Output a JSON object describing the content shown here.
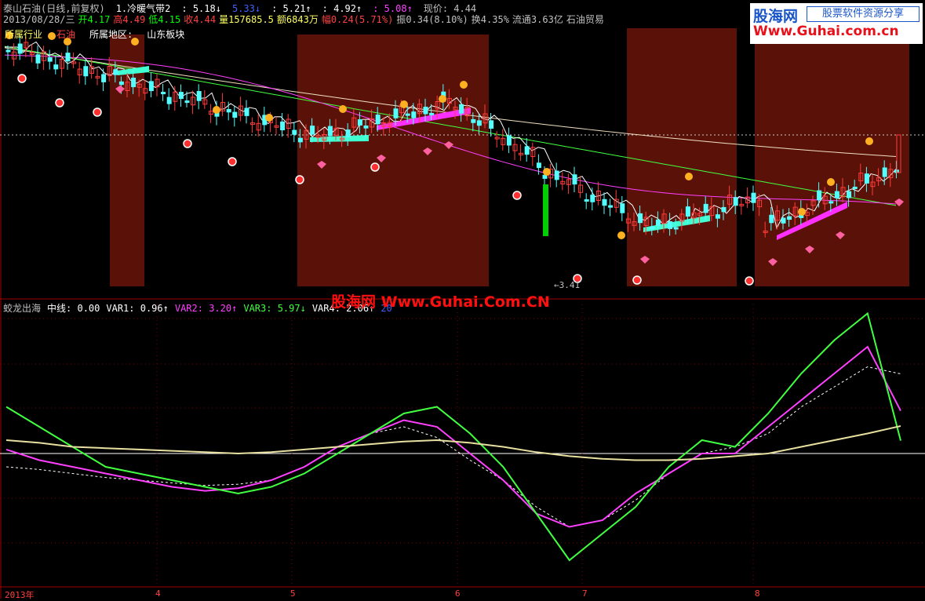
{
  "header": {
    "line1": [
      {
        "text": "泰山石油(日线,前复权)",
        "color": "#c0c0c0"
      },
      {
        "text": "1.冷暖气带2",
        "color": "#ffffff"
      },
      {
        "text": ": 5.18↓",
        "color": "#ffffff"
      },
      {
        "text": "5.33↓",
        "color": "#4060ff"
      },
      {
        "text": ": 5.21↑",
        "color": "#ffffff"
      },
      {
        "text": ": 4.92↑",
        "color": "#ffffff"
      },
      {
        "text": ": 5.08↑",
        "color": "#ff40ff"
      },
      {
        "text": "现价: 4.44",
        "color": "#c0c0c0"
      }
    ],
    "line2": [
      {
        "text": "2013/08/28/三",
        "color": "#c0c0c0"
      },
      {
        "text": "开4.17",
        "color": "#00ff00"
      },
      {
        "text": "高4.49",
        "color": "#ff4040"
      },
      {
        "text": "低4.15",
        "color": "#00ff00"
      },
      {
        "text": "收4.44",
        "color": "#ff4040"
      },
      {
        "text": "量157685.5",
        "color": "#ffff60"
      },
      {
        "text": "额6843万",
        "color": "#ffff60"
      },
      {
        "text": "幅0.24(5.71%)",
        "color": "#ff4040"
      },
      {
        "text": "振0.34(8.10%)",
        "color": "#c0c0c0"
      },
      {
        "text": "换4.35%",
        "color": "#c0c0c0"
      },
      {
        "text": "流通3.63亿",
        "color": "#c0c0c0"
      },
      {
        "text": "石油贸易",
        "color": "#c0c0c0"
      }
    ],
    "line3": [
      {
        "text": "所属行业",
        "color": "#ffff60"
      },
      {
        "text": "石油",
        "color": "#ff4040"
      },
      {
        "text": "所属地区:",
        "color": "#ffffff"
      },
      {
        "text": "山东板块",
        "color": "#ffffff"
      }
    ]
  },
  "indicator": {
    "items": [
      {
        "text": "蛟龙出海",
        "color": "#c0c0c0"
      },
      {
        "text": "中线: 0.00",
        "color": "#ffffff"
      },
      {
        "text": "VAR1: 0.96↑",
        "color": "#ffffff"
      },
      {
        "text": "VAR2: 3.20↑",
        "color": "#ff40ff"
      },
      {
        "text": "VAR3: 5.97↓",
        "color": "#40ff40"
      },
      {
        "text": "VAR4: 2.06↑",
        "color": "#ffffff"
      },
      {
        "text": "20",
        "color": "#4060ff"
      }
    ]
  },
  "low_marker": "←3.41",
  "logo": {
    "main": "股海网",
    "tagline": "股票软件资源分享",
    "url": "Www.Guhai.com.cn"
  },
  "watermark": "股海网 Www.Guhai.Com.CN",
  "x_axis_labels": [
    "2013年",
    "4",
    "5",
    "6",
    "7",
    "8"
  ],
  "colors": {
    "up": "#ff3b3b",
    "down": "#54ffff",
    "zone": "#5a1208",
    "ma_white": "#ffffff",
    "ma_magenta": "#ff40ff",
    "ma_green": "#40ff40",
    "ma_pale": "#f0e0c0"
  },
  "chart_data": [
    {
      "type": "candlestick",
      "title": "泰山石油(日线,前复权)",
      "last_close": 4.44,
      "open": 4.17,
      "high": 4.49,
      "low": 4.15,
      "close": 4.44,
      "series": [
        {
          "name": "MA white",
          "values": [
            5.6,
            5.55,
            5.45,
            5.4,
            5.3,
            5.2,
            5.1,
            5.0,
            4.95,
            4.9,
            4.9,
            4.95,
            5.05,
            5.15,
            5.2,
            5.1,
            4.95,
            4.75,
            4.6,
            4.4,
            4.2,
            4.05,
            4.0,
            4.1,
            4.25,
            4.3,
            4.35,
            4.4
          ]
        },
        {
          "name": "MA magenta",
          "values": [
            5.7,
            5.65,
            5.6,
            5.5,
            5.4,
            5.3,
            5.2,
            5.1,
            5.0,
            4.95,
            4.95,
            5.0,
            5.05,
            5.1,
            5.15,
            5.1,
            5.0,
            4.85,
            4.7,
            4.55,
            4.4,
            4.3,
            4.2,
            4.15,
            4.2,
            4.25,
            4.3,
            4.3
          ]
        }
      ]
    },
    {
      "type": "line",
      "title": "蛟龙出海",
      "series": [
        {
          "name": "中线",
          "values": [
            0,
            0,
            0,
            0,
            0,
            0,
            0,
            0,
            0,
            0,
            0,
            0,
            0,
            0,
            0,
            0,
            0,
            0,
            0,
            0,
            0,
            0,
            0,
            0,
            0,
            0,
            0,
            0
          ]
        },
        {
          "name": "VAR1",
          "values": [
            -1.0,
            -1.2,
            -1.5,
            -1.8,
            -2.0,
            -2.2,
            -2.4,
            -2.3,
            -2.0,
            -1.0,
            0.5,
            1.5,
            2.0,
            1.2,
            -0.5,
            -2.0,
            -4.0,
            -5.5,
            -5.0,
            -3.5,
            -1.5,
            0.0,
            0.5,
            1.5,
            3.5,
            5.0,
            6.5,
            5.97
          ]
        },
        {
          "name": "VAR2",
          "values": [
            0.3,
            -0.5,
            -1.0,
            -1.5,
            -2.0,
            -2.5,
            -2.8,
            -2.6,
            -2.0,
            -1.0,
            0.5,
            1.5,
            2.5,
            2.0,
            0.0,
            -2.0,
            -4.5,
            -5.5,
            -5.0,
            -3.0,
            -1.5,
            0.0,
            0.0,
            2.0,
            4.0,
            6.0,
            8.0,
            3.2
          ]
        },
        {
          "name": "VAR3",
          "values": [
            3.5,
            2.0,
            0.5,
            -1.0,
            -1.5,
            -2.0,
            -2.5,
            -3.0,
            -2.5,
            -1.5,
            0.0,
            1.5,
            3.0,
            3.5,
            1.5,
            -1.0,
            -4.5,
            -8.0,
            -6.0,
            -4.0,
            -1.0,
            1.0,
            0.5,
            3.0,
            6.0,
            8.5,
            10.5,
            0.96
          ]
        },
        {
          "name": "VAR4",
          "values": [
            1.0,
            0.8,
            0.5,
            0.4,
            0.3,
            0.2,
            0.1,
            0.0,
            0.1,
            0.3,
            0.5,
            0.7,
            0.9,
            1.0,
            0.8,
            0.5,
            0.1,
            -0.2,
            -0.4,
            -0.5,
            -0.5,
            -0.4,
            -0.2,
            0.0,
            0.5,
            1.0,
            1.5,
            2.06
          ]
        }
      ]
    }
  ]
}
